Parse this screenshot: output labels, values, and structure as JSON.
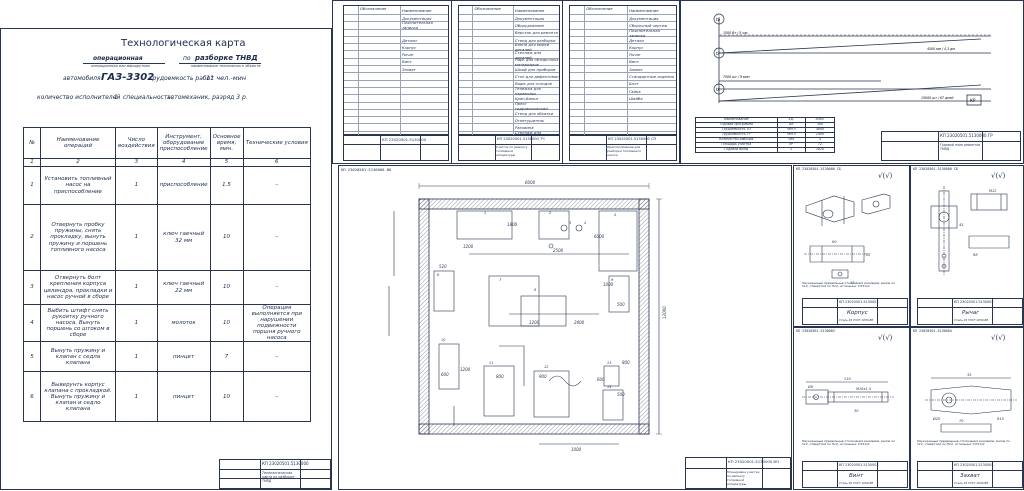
{
  "card": {
    "title": "Технологическая карта",
    "operation_label": "операционная",
    "operation_sub": "операционная или маршрутная",
    "po_label": "по",
    "work_name": "разборке ТНВД",
    "work_sub": "наименование технического объекта",
    "auto_label": "автомобиля",
    "model": "ГАЗ-3302",
    "labor_label": "трудоемкость работ",
    "labor_value": "11 чел.-мин",
    "staff_label": "количество исполнителей",
    "staff_count": "1",
    "staff_specialty_label": "специальность",
    "staff_specialty": "автомеханик, разряд 3 р.",
    "headers": [
      "№",
      "Наименование операций",
      "Число воздействия",
      "Инструмент, оборудование приспособление",
      "Основное время, мин.",
      "Технические условия"
    ],
    "col_numbers": [
      "1",
      "2",
      "3",
      "4",
      "5",
      "6"
    ],
    "rows": [
      {
        "n": "1",
        "op": "Установить топливный насос на приспособление",
        "count": "1",
        "tool": "приспособление",
        "time": "1.5",
        "cond": "–"
      },
      {
        "n": "2",
        "op": "Отвернуть пробку пружины, снять прокладку, вынуть пружину и поршень топливного насоса",
        "count": "1",
        "tool": "ключ гаечный 32 мм",
        "time": "10",
        "cond": "–"
      },
      {
        "n": "3",
        "op": "Отвернуть болт крепления корпуса цилиндра, прокладки и насос ручной в сборе",
        "count": "1",
        "tool": "ключ гаечный 22 мм",
        "time": "10",
        "cond": "–"
      },
      {
        "n": "4",
        "op": "Выбить штифт снять рукоятку ручного насоса. Вынуть поршень со штоком в сборе",
        "count": "1",
        "tool": "молоток",
        "time": "10",
        "cond": "Операция выполняется при нарушении подвижности поршня ручного насоса"
      },
      {
        "n": "5",
        "op": "Вынуть пружину и клапан с седла клапана",
        "count": "1",
        "tool": "пинцет",
        "time": "7",
        "cond": "–"
      },
      {
        "n": "6",
        "op": "Выверунть корпус клапана с прокладкой. Вынуть пружину и клапан и седло клапана",
        "count": "1",
        "tool": "пинцет",
        "time": "10",
        "cond": "–"
      }
    ],
    "stamp_code": "КП 23020501.5130000",
    "stamp_name": "Технологическая карта по разборке ТНВД"
  },
  "spec1": {
    "header": [
      "Обозначение",
      "Наименование"
    ],
    "items": [
      "Документация",
      "Пояснительная записка",
      "Детали",
      "Корпус",
      "Рычаг",
      "Винт",
      "Захват"
    ],
    "stamp_code": "КП 23020501.5130000"
  },
  "spec2": {
    "header": [
      "Обозначение",
      "Наименование"
    ],
    "items": [
      "Документация",
      "Оборудование",
      "Верстак для ремонта",
      "Стенд для разборки",
      "Ванна для мойки деталей",
      "Стеллаж для деталей",
      "Ларь для обтирочных материалов",
      "Шкаф для приборов",
      "Стол для дефектовки",
      "Ящик для отходов",
      "Тележка для перевозки",
      "Кран-балка",
      "Пресс гидравлический",
      "Стенд для обкатки",
      "Огнетушитель",
      "Раковина",
      "Стеллаж для инструмента",
      "Ванна для промывки",
      "Стол для сборки",
      "Подставка для узлов",
      "Стенд проверки ТНВД",
      "Шкаф для одежды"
    ],
    "stamp_code": "КП 23020501.5130000 ТЧ",
    "stamp_name": "Участок по ремонту топливной аппаратуры"
  },
  "spec3": {
    "header": [
      "Обозначение",
      "Наименование"
    ],
    "items": [
      "Документация",
      "Сборочный чертеж",
      "Пояснительная записка",
      "Детали",
      "Корпус",
      "Рычаг",
      "Винт",
      "Захват",
      "Стандартные изделия",
      "Болт",
      "Гайка",
      "Шайба"
    ],
    "stamp_code": "КП 23020501.5130000 СП",
    "stamp_name": "Приспособление для разборки топливного насоса"
  },
  "graph": {
    "labels": {
      "t0": "t0",
      "ti": "ti",
      "tk": "tk",
      "kr": "КР"
    },
    "axis_notes": [
      "1500 Вт / 5 час",
      "4500 мм / 4,3 дм",
      "7500 шт / 9 мин",
      "15000 шт / 67 дней"
    ],
    "table_head": [
      "Наименование",
      "Ед.",
      "Знач."
    ],
    "table_rows": [
      [
        "Годовая программа",
        "шт",
        "300"
      ],
      [
        "Трудоемкость ТО",
        "чел.ч",
        "4800"
      ],
      [
        "Трудоемкость ТР",
        "чел.ч",
        "2400"
      ],
      [
        "Количество рабочих",
        "чел",
        "4"
      ],
      [
        "Площадь участка",
        "м²",
        "72"
      ],
      [
        "Годовой фонд",
        "ч",
        "1820"
      ]
    ],
    "stamp_code": "КП 23020501.5130000 ГР",
    "stamp_name": "Годовой план ремонтов ТНВД"
  },
  "plan": {
    "top_label": "КП 23020501.5130000 ВО",
    "dims": {
      "width_total": "6000",
      "height_total": "12000",
      "d1": "1200",
      "d2": "1800",
      "d3": "2500",
      "d4": "6000",
      "d5": "1000",
      "d6": "800",
      "d7": "900",
      "d8": "1200",
      "d9": "2400",
      "d10": "500",
      "d11": "600",
      "d12": "1000",
      "d13": "520",
      "d14": "1200",
      "d15": "600",
      "d16": "800",
      "d17": "500"
    },
    "markers": [
      "1",
      "2",
      "3",
      "4",
      "5",
      "6",
      "7",
      "8",
      "9",
      "10",
      "11",
      "12",
      "13",
      "14",
      "15",
      "16",
      "17",
      "18",
      "19",
      "20",
      "21",
      "22"
    ],
    "stamp_code": "КП 23020501.5130000 ВО",
    "stamp_name": "Планировка участка по ремонту топливной аппаратуры"
  },
  "parts": [
    {
      "top_label": "КП 23020501.5130000 СБ",
      "roughness": "√(√)",
      "note": "Неуказанные предельные отклонения размеров: валов по h14, отверстий по H14, остальных ±IT14/2",
      "stamp_code": "КП 23020501.5130001",
      "name": "Корпус",
      "material": "Сталь 45 ГОСТ 1050-88"
    },
    {
      "top_label": "КП 23020501.5130000 СБ",
      "roughness": "√(√)",
      "note": "Неуказанные предельные отклонения размеров: валов по h14, отверстий по H14, остальных ±IT14/2",
      "stamp_code": "КП 23020501.5130002",
      "name": "Рычаг",
      "material": "Сталь 45 ГОСТ 1050-88"
    },
    {
      "top_label": "КП 23020501.5130003",
      "roughness": "√(√)",
      "note": "Неуказанные предельные отклонения размеров: валов по h14, отверстий по H14, остальных ±IT14/2",
      "stamp_code": "КП 23020501.5130003",
      "name": "Винт",
      "material": "Сталь 45 ГОСТ 1050-88"
    },
    {
      "top_label": "КП 23020501.5130004",
      "roughness": "√(√)",
      "note": "Неуказанные предельные отклонения размеров: валов по h14, отверстий по H14, остальных ±IT14/2",
      "stamp_code": "КП 23020501.5130004",
      "name": "Захват",
      "material": "Сталь 45 ГОСТ 1050-88"
    }
  ],
  "part_dims": [
    "60",
    "22",
    "12",
    "45",
    "R8",
    "M12",
    "110",
    "Ø8",
    "30",
    "35",
    "70",
    "M16x1,5",
    "Ø20",
    "120",
    "25",
    "R15"
  ],
  "colors": {
    "ink": "#2a3550",
    "paper": "#ffffff",
    "model_dark": "#3a3a3a",
    "model_light": "#8a8a8a"
  }
}
